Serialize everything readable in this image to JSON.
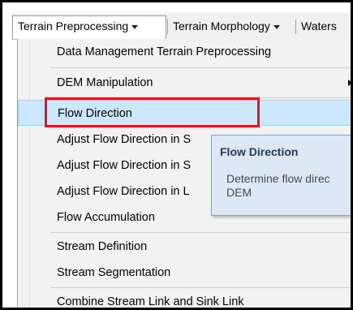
{
  "toolbar": {
    "items": [
      {
        "label": "Terrain Preprocessing"
      },
      {
        "label": "Terrain Morphology"
      },
      {
        "label": "Waters"
      }
    ]
  },
  "menu": {
    "items": [
      {
        "label": "Data Management Terrain Preprocessing"
      },
      {
        "label": "DEM Manipulation",
        "has_submenu": true
      },
      {
        "label": "Flow Direction",
        "highlighted": true
      },
      {
        "label": "Adjust Flow Direction in S"
      },
      {
        "label": "Adjust Flow Direction in S"
      },
      {
        "label": "Adjust Flow Direction in L"
      },
      {
        "label": "Flow Accumulation"
      },
      {
        "label": "Stream Definition"
      },
      {
        "label": "Stream Segmentation"
      },
      {
        "label": "Combine Stream Link and Sink Link"
      }
    ]
  },
  "tooltip": {
    "title": "Flow Direction",
    "body": "Determine flow direc\nDEM"
  },
  "colors": {
    "highlight_fill": "#cce8ff",
    "highlight_border": "#99d1ff",
    "annotation_red": "#e8141b",
    "tooltip_bg": "#dde8f4"
  }
}
